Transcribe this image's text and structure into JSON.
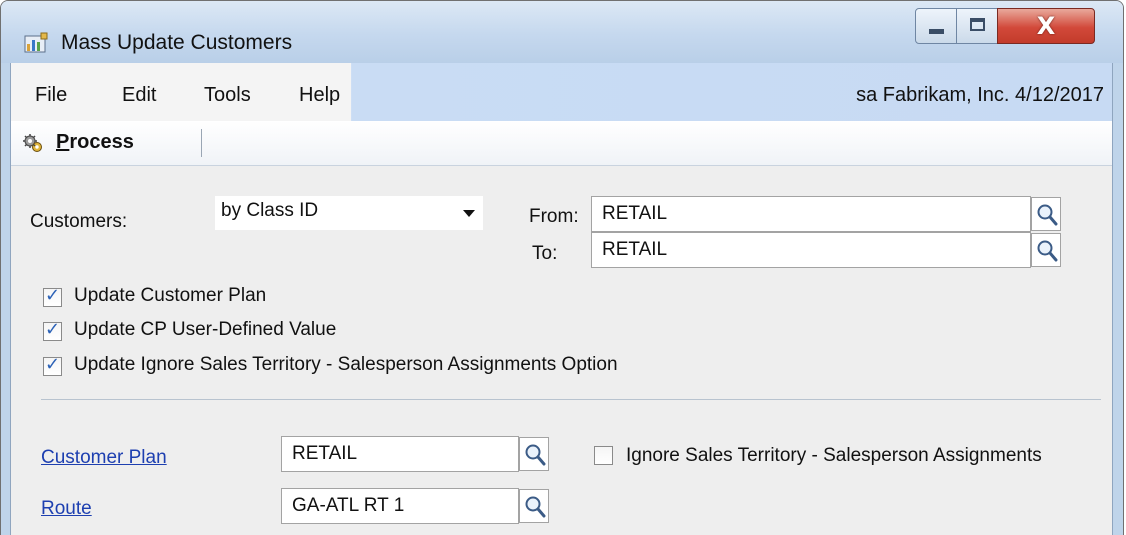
{
  "window": {
    "title": "Mass Update Customers",
    "close_symbol": "X"
  },
  "menu": {
    "items": [
      "File",
      "Edit",
      "Tools",
      "Help"
    ],
    "status": "sa  Fabrikam, Inc.  4/12/2017"
  },
  "toolbar": {
    "process_label_underlined": "P",
    "process_label_rest": "rocess",
    "process_icon": "gears-icon"
  },
  "form": {
    "customers_label": "Customers:",
    "customers_value": "by Class ID",
    "from_label": "From:",
    "from_value": "RETAIL",
    "to_label": "To:",
    "to_value": "RETAIL",
    "checkboxes": [
      {
        "label": "Update Customer Plan",
        "checked": true
      },
      {
        "label": "Update CP User-Defined Value",
        "checked": true
      },
      {
        "label": "Update Ignore Sales Territory - Salesperson Assignments Option",
        "checked": true
      }
    ],
    "customer_plan_link": "Customer Plan",
    "customer_plan_value": "RETAIL",
    "ignore_territory_label": "Ignore Sales Territory - Salesperson Assignments",
    "ignore_territory_checked": false,
    "route_link": "Route",
    "route_value": "GA-ATL RT 1"
  },
  "colors": {
    "link": "#1d3fb0",
    "checkmark": "#2c62b7",
    "close_button": "#d2493a",
    "menubar_accent": "#c7daf3"
  }
}
